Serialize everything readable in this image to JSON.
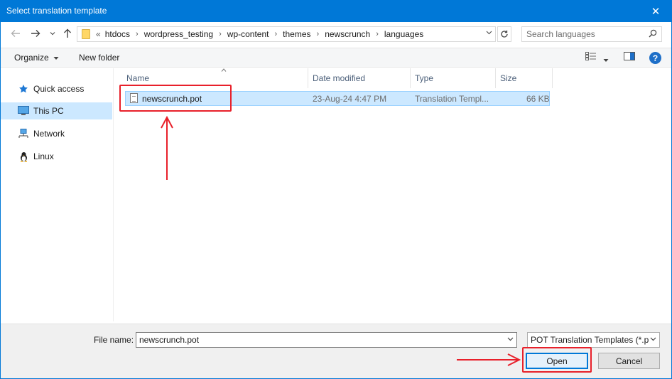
{
  "window": {
    "title": "Select translation template",
    "close_glyph": "✕"
  },
  "nav": {
    "back_icon": "arrow-left-icon",
    "forward_icon": "arrow-right-icon",
    "recent_icon": "chevron-down-icon",
    "up_icon": "arrow-up-icon",
    "overflow_glyph": "«",
    "breadcrumbs": [
      "htdocs",
      "wordpress_testing",
      "wp-content",
      "themes",
      "newscrunch",
      "languages"
    ],
    "search_placeholder": "Search languages"
  },
  "toolbar": {
    "organize_label": "Organize",
    "new_folder_label": "New folder"
  },
  "sidebar": {
    "items": [
      {
        "label": "Quick access",
        "icon": "star-icon"
      },
      {
        "label": "This PC",
        "icon": "monitor-icon"
      },
      {
        "label": "Network",
        "icon": "network-icon"
      },
      {
        "label": "Linux",
        "icon": "linux-penguin-icon"
      }
    ],
    "selected_index": 1
  },
  "file_list": {
    "columns": [
      "Name",
      "Date modified",
      "Type",
      "Size"
    ],
    "rows": [
      {
        "name": "newscrunch.pot",
        "date": "23-Aug-24 4:47 PM",
        "type": "Translation Templ...",
        "size": "66 KB"
      }
    ]
  },
  "footer": {
    "file_name_label": "File name:",
    "file_name_value": "newscrunch.pot",
    "filter_value": "POT Translation Templates (*.po",
    "open_label": "Open",
    "cancel_label": "Cancel"
  },
  "colors": {
    "titlebar": "#0078d7",
    "selection": "#cce8ff",
    "annotation": "#e8202a"
  }
}
